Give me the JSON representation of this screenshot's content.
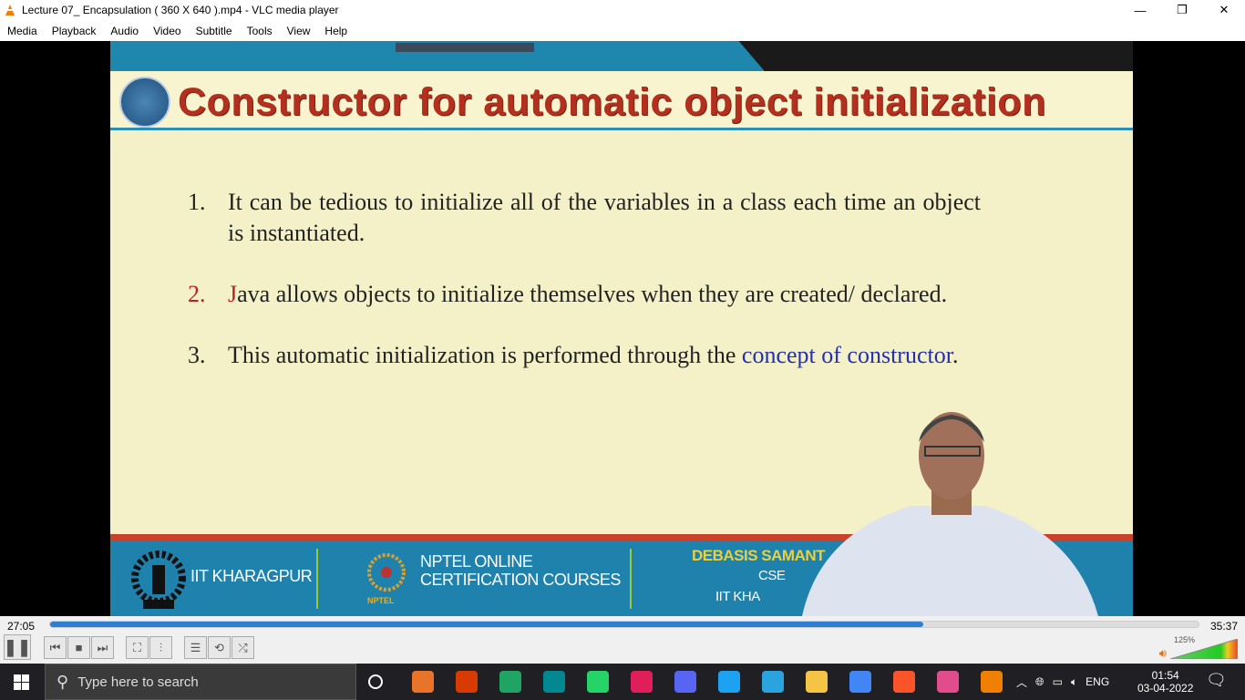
{
  "window": {
    "title": "Lecture 07_ Encapsulation ( 360 X 640 ).mp4 - VLC media player",
    "minimize": "—",
    "maximize": "❐",
    "close": "✕"
  },
  "menu": [
    "Media",
    "Playback",
    "Audio",
    "Video",
    "Subtitle",
    "Tools",
    "View",
    "Help"
  ],
  "slide": {
    "title": "Constructor for automatic object initialization",
    "points": [
      {
        "num": "1.",
        "text": "It can be tedious to initialize all of the variables in a class each time an object is instantiated."
      },
      {
        "num": "2.",
        "first": "J",
        "text": "ava allows objects to initialize themselves when they are created/ declared."
      },
      {
        "num": "3.",
        "text": "This automatic initialization is performed through the ",
        "highlight": "concept of constructor",
        "end": "."
      }
    ],
    "banner": {
      "inst": "IIT KHARAGPUR",
      "nptel1": "NPTEL ONLINE",
      "nptel2": "CERTIFICATION COURSES",
      "nptel_logo": "NPTEL",
      "name": "DEBASIS SAMANT",
      "dept": "CSE",
      "inst2": "IIT KHA"
    }
  },
  "player": {
    "elapsed": "27:05",
    "total": "35:37",
    "progress": 0.76,
    "volume": "125%",
    "volume_level": 1.25
  },
  "taskbar": {
    "search_placeholder": "Type here to search",
    "lang": "ENG",
    "time": "01:54",
    "date": "03-04-2022",
    "apps": [
      {
        "name": "cortana",
        "color": "#ffffff"
      },
      {
        "name": "matlab",
        "color": "#e8742a"
      },
      {
        "name": "office",
        "color": "#d83b01"
      },
      {
        "name": "app-green",
        "color": "#1fa463"
      },
      {
        "name": "arduino",
        "color": "#00878f"
      },
      {
        "name": "whatsapp",
        "color": "#25d366"
      },
      {
        "name": "slack",
        "color": "#e01e5a"
      },
      {
        "name": "discord",
        "color": "#5865f2"
      },
      {
        "name": "twitter",
        "color": "#1da1f2"
      },
      {
        "name": "telegram",
        "color": "#2aa3df"
      },
      {
        "name": "file-explorer",
        "color": "#f6c445"
      },
      {
        "name": "chrome",
        "color": "#4285f4"
      },
      {
        "name": "brave",
        "color": "#fb542b"
      },
      {
        "name": "intellij",
        "color": "#e04c8c"
      },
      {
        "name": "vlc",
        "color": "#f08000"
      }
    ]
  }
}
